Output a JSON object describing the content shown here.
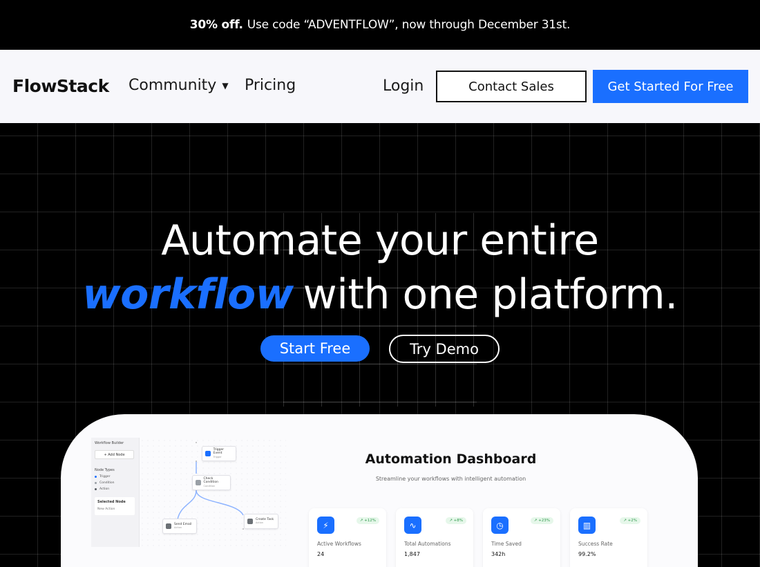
{
  "promo": {
    "bold": "30% off.",
    "text": "Use code “ADVENTFLOW”, now through December 31st."
  },
  "nav": {
    "brand": "FlowStack",
    "community": "Community",
    "pricing": "Pricing",
    "login": "Login",
    "contact": "Contact Sales",
    "get_started": "Get Started For Free"
  },
  "hero": {
    "line1": "Automate your entire",
    "accent": "workflow",
    "line2_rest": "with one platform.",
    "start": "Start Free",
    "demo": "Try Demo"
  },
  "workflow_builder": {
    "title": "Workflow Builder",
    "add_node": "+ Add Node",
    "node_types": "Node Types",
    "types": [
      {
        "label": "Trigger",
        "color": "#1a6fff"
      },
      {
        "label": "Condition",
        "color": "#9aa0a6"
      },
      {
        "label": "Action",
        "color": "#555a60"
      }
    ],
    "selected_title": "Selected Node",
    "selected_value": "New Action",
    "nodes": [
      {
        "label": "Trigger Event",
        "sub": "Trigger",
        "color": "#1a6fff"
      },
      {
        "label": "Check Condition",
        "sub": "Condition",
        "color": "#9aa0a6"
      },
      {
        "label": "Send Email",
        "sub": "Action",
        "color": "#6b7075"
      },
      {
        "label": "Create Task",
        "sub": "Action",
        "color": "#6b7075"
      }
    ]
  },
  "dashboard": {
    "title": "Automation Dashboard",
    "subtitle": "Streamline your workflows with intelligent automation",
    "cards": [
      {
        "label": "Active Workflows",
        "value": "24",
        "badge": "↗ +12%",
        "icon": "lightning-icon",
        "icon_glyph": "⚡",
        "color": "#1a6fff"
      },
      {
        "label": "Total Automations",
        "value": "1,847",
        "badge": "↗ +8%",
        "icon": "activity-icon",
        "icon_glyph": "∿",
        "color": "#1a6fff"
      },
      {
        "label": "Time Saved",
        "value": "342h",
        "badge": "↗ +23%",
        "icon": "clock-icon",
        "icon_glyph": "◷",
        "color": "#1a6fff"
      },
      {
        "label": "Success Rate",
        "value": "99.2%",
        "badge": "↗ +2%",
        "icon": "bar-chart-icon",
        "icon_glyph": "▥",
        "color": "#1a6fff"
      }
    ]
  },
  "colors": {
    "accent": "#1a6fff",
    "nav_bg": "#f7f7fb",
    "hero_bg": "#000000"
  }
}
